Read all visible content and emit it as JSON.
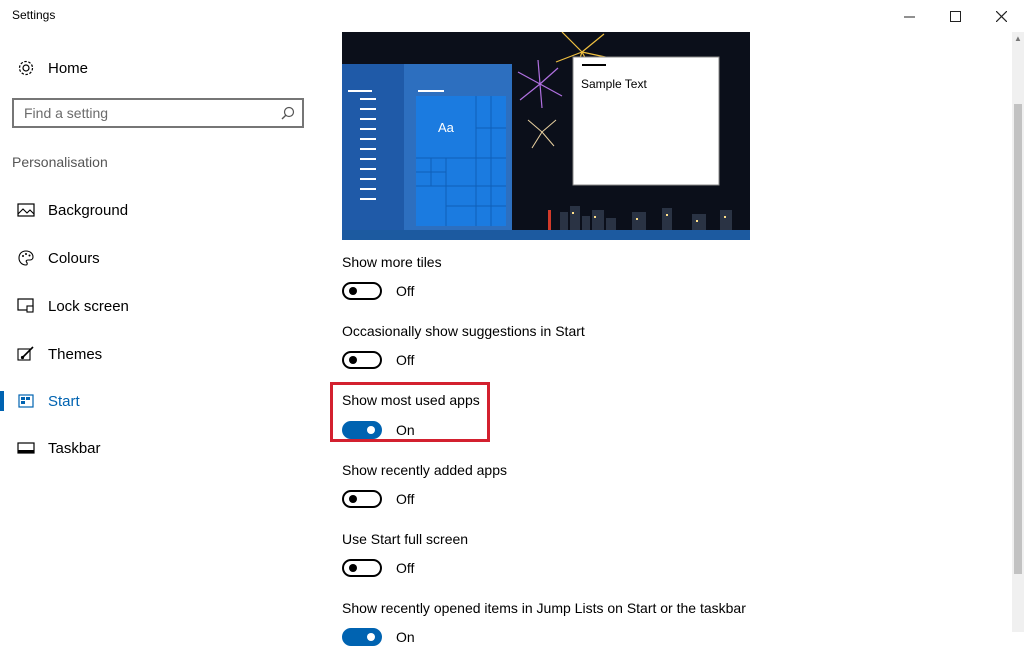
{
  "window": {
    "title": "Settings",
    "controls": {
      "minimize": "minimize",
      "maximize": "maximize",
      "close": "close"
    }
  },
  "sidebar": {
    "home_label": "Home",
    "search_placeholder": "Find a setting",
    "section_label": "Personalisation",
    "items": [
      {
        "label": "Background",
        "icon": "image-icon",
        "active": false
      },
      {
        "label": "Colours",
        "icon": "palette-icon",
        "active": false
      },
      {
        "label": "Lock screen",
        "icon": "lock-screen-icon",
        "active": false
      },
      {
        "label": "Themes",
        "icon": "brush-icon",
        "active": false
      },
      {
        "label": "Start",
        "icon": "start-icon",
        "active": true
      },
      {
        "label": "Taskbar",
        "icon": "taskbar-icon",
        "active": false
      }
    ]
  },
  "preview": {
    "sample_text": "Sample Text",
    "tile_text": "Aa"
  },
  "settings": [
    {
      "label": "Show more tiles",
      "state": "Off",
      "on": false
    },
    {
      "label": "Occasionally show suggestions in Start",
      "state": "Off",
      "on": false
    },
    {
      "label": "Show most used apps",
      "state": "On",
      "on": true
    },
    {
      "label": "Show recently added apps",
      "state": "Off",
      "on": false
    },
    {
      "label": "Use Start full screen",
      "state": "Off",
      "on": false
    },
    {
      "label": "Show recently opened items in Jump Lists on Start or the taskbar",
      "state": "On",
      "on": true
    }
  ],
  "colors": {
    "accent": "#0063b1",
    "highlight_border": "#d3202f"
  }
}
